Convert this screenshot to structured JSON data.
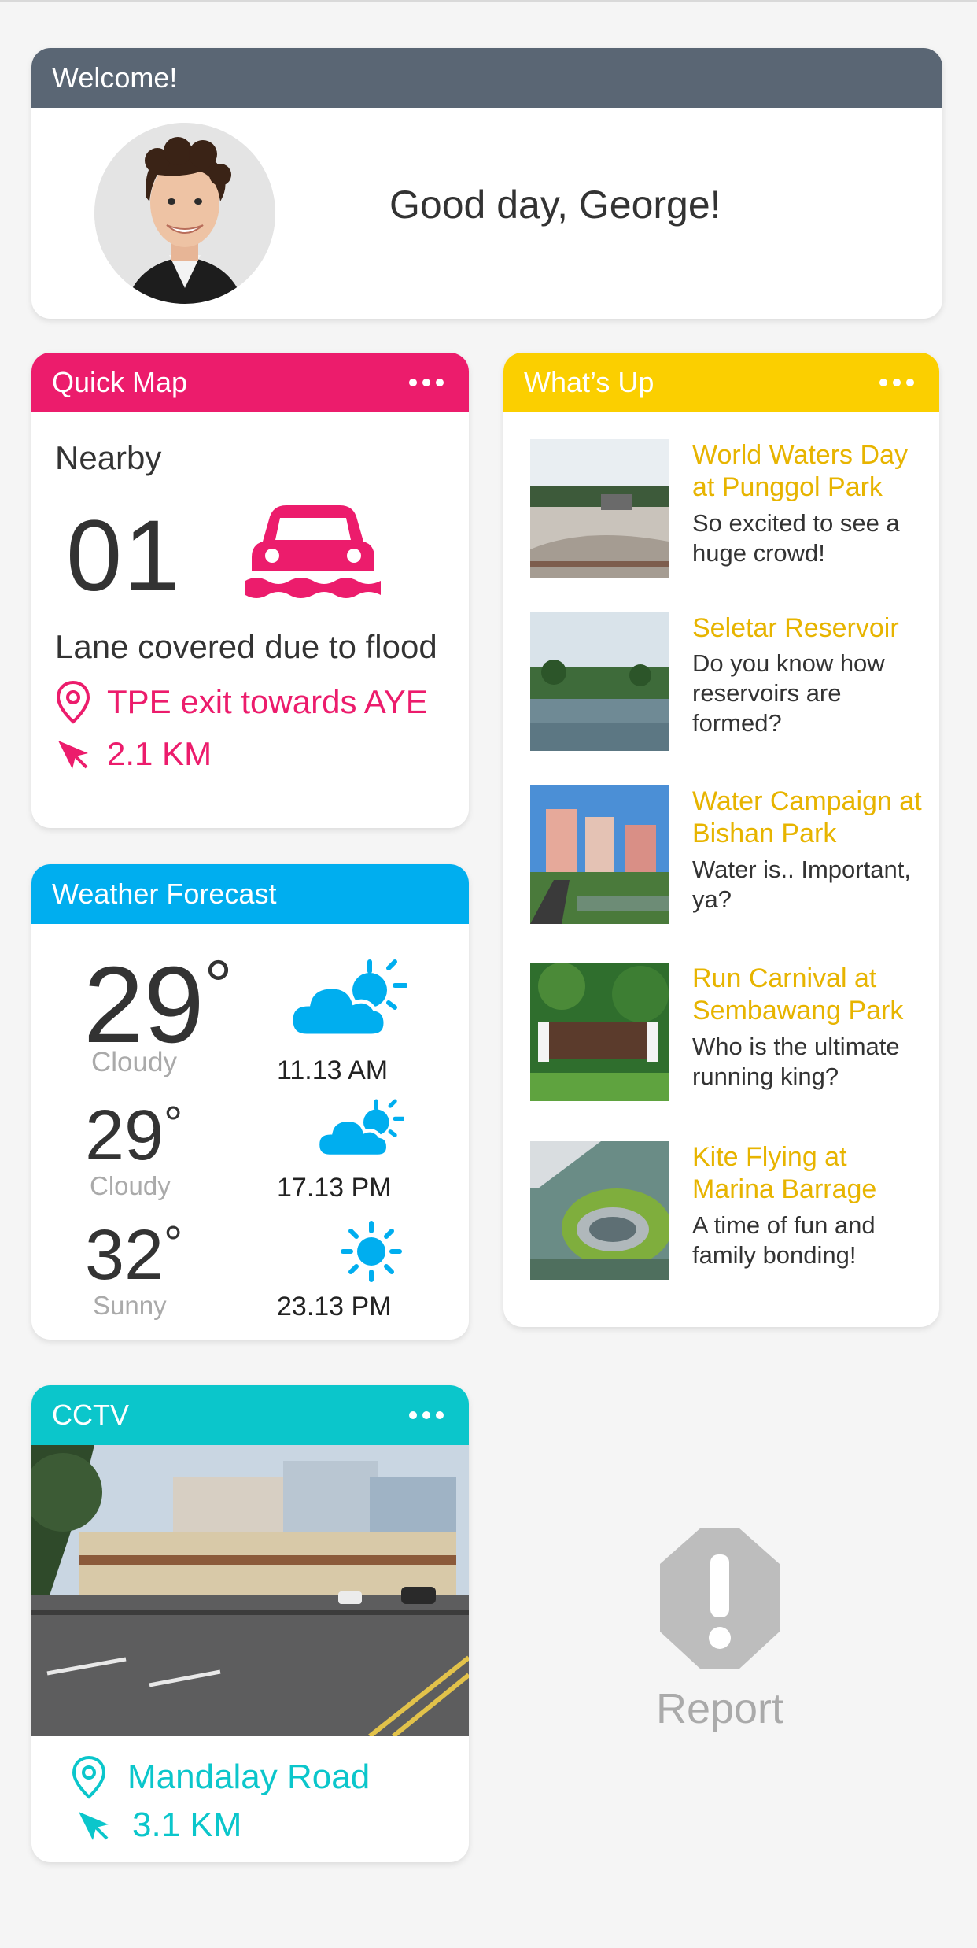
{
  "welcome": {
    "header": "Welcome!",
    "greeting": "Good day, George!"
  },
  "quick_map": {
    "header": "Quick Map",
    "nearby_label": "Nearby",
    "count": "01",
    "description": "Lane covered due to flood",
    "location": "TPE exit towards AYE",
    "distance": "2.1 KM",
    "icon": "flooded-car-icon",
    "accent": "#ec1c6c"
  },
  "weather": {
    "header": "Weather Forecast",
    "accent": "#00aeef",
    "rows": [
      {
        "temp": "29",
        "unit": "°",
        "condition": "Cloudy",
        "time": "11.13 AM",
        "icon": "partly-cloudy-icon"
      },
      {
        "temp": "29",
        "unit": "°",
        "condition": "Cloudy",
        "time": "17.13 PM",
        "icon": "partly-cloudy-icon"
      },
      {
        "temp": "32",
        "unit": "°",
        "condition": "Sunny",
        "time": "23.13 PM",
        "icon": "sun-icon"
      }
    ]
  },
  "whats_up": {
    "header": "What’s Up",
    "accent": "#fbcf00",
    "items": [
      {
        "title": "World Waters Day at Punggol Park",
        "subtitle": "So excited to see a huge crowd!"
      },
      {
        "title": "Seletar Reservoir",
        "subtitle": "Do you know how reservoirs are formed?"
      },
      {
        "title": "Water Campaign at Bishan Park",
        "subtitle": "Water is.. Important, ya?"
      },
      {
        "title": "Run Carnival at Sembawang Park",
        "subtitle": "Who is the ultimate running king?"
      },
      {
        "title": "Kite Flying at Marina Barrage",
        "subtitle": "A time of fun and family bonding!"
      }
    ]
  },
  "cctv": {
    "header": "CCTV",
    "accent": "#0bc6cb",
    "location": "Mandalay Road",
    "distance": "3.1 KM"
  },
  "report": {
    "label": "Report"
  }
}
